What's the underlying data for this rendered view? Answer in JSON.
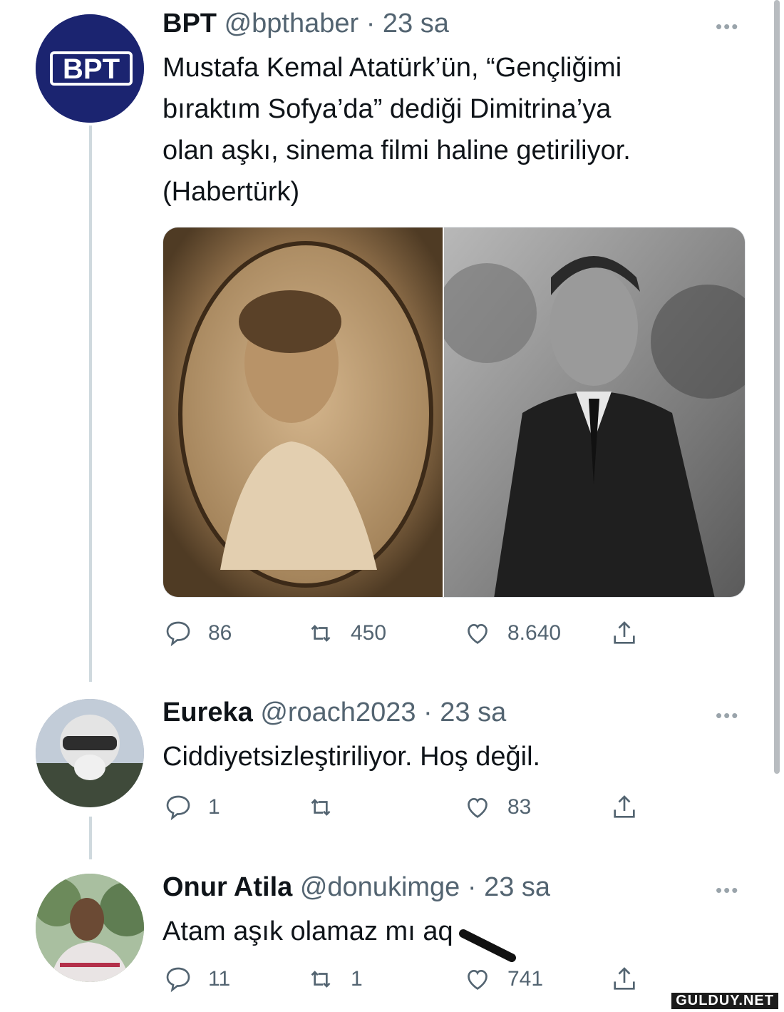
{
  "tweets": [
    {
      "name": "BPT",
      "handle": "@bpthaber",
      "time": "· 23 sa",
      "text_lines": [
        "Mustafa Kemal Atatürk’ün, “Gençliğimi",
        "bıraktım Sofya’da” dediği Dimitrina’ya",
        "olan aşkı, sinema filmi haline getiriliyor.",
        "(Habertürk)"
      ],
      "avatar_text": "BPT",
      "replies": "86",
      "retweets": "450",
      "likes": "8.640"
    },
    {
      "name": "Eureka",
      "handle": "@roach2023",
      "time": "· 23 sa",
      "text_lines": [
        "Ciddiyetsizleştiriliyor. Hoş değil."
      ],
      "replies": "1",
      "retweets": "",
      "likes": "83"
    },
    {
      "name": "Onur Atila",
      "handle": "@donukimge",
      "time": "· 23 sa",
      "text_lines": [
        "Atam aşık olamaz mı aq"
      ],
      "replies": "11",
      "retweets": "1",
      "likes": "741"
    }
  ],
  "more_glyph": "•••",
  "watermark": "GULDUY.NET",
  "colors": {
    "text": "#0f1419",
    "secondary": "#536471",
    "avatar_bpt": "#1b2470",
    "thread_line": "#cfd9de"
  },
  "icons": [
    "reply-icon",
    "retweet-icon",
    "like-icon",
    "share-icon",
    "more-icon"
  ]
}
